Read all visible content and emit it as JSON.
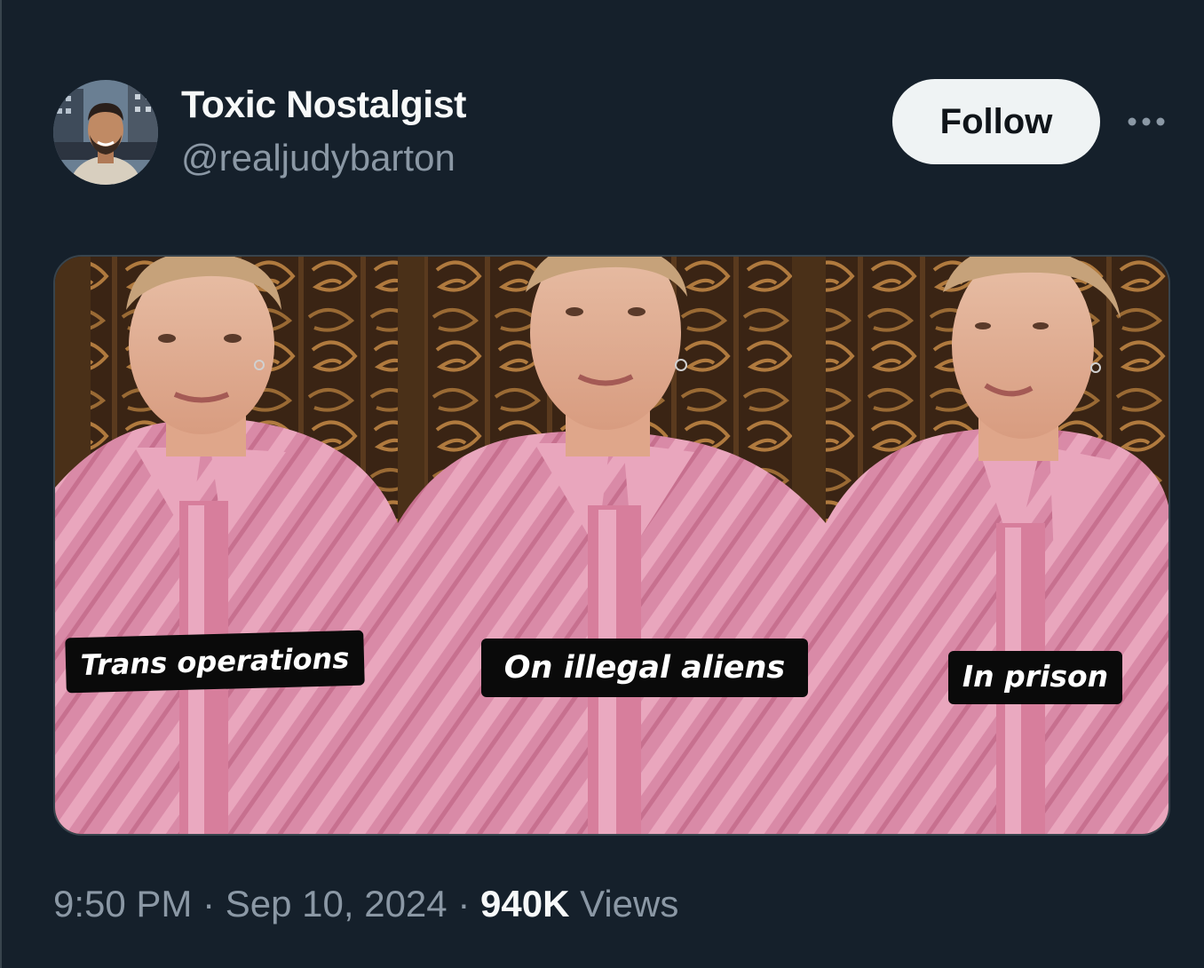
{
  "author": {
    "display_name": "Toxic Nostalgist",
    "handle": "@realjudybarton"
  },
  "actions": {
    "follow_label": "Follow",
    "more_icon": "more-horizontal-icon"
  },
  "media": {
    "panels": [
      {
        "caption": "Trans operations"
      },
      {
        "caption": "On illegal aliens"
      },
      {
        "caption": "In prison"
      }
    ]
  },
  "meta": {
    "time": "9:50 PM",
    "separator": "·",
    "date": "Sep 10, 2024",
    "views_count": "940K",
    "views_label": "Views"
  },
  "colors": {
    "background": "#15202b",
    "primary_text": "#f7f9f9",
    "secondary_text": "#8b98a5",
    "follow_button_bg": "#eff3f4",
    "border": "#38444d"
  }
}
